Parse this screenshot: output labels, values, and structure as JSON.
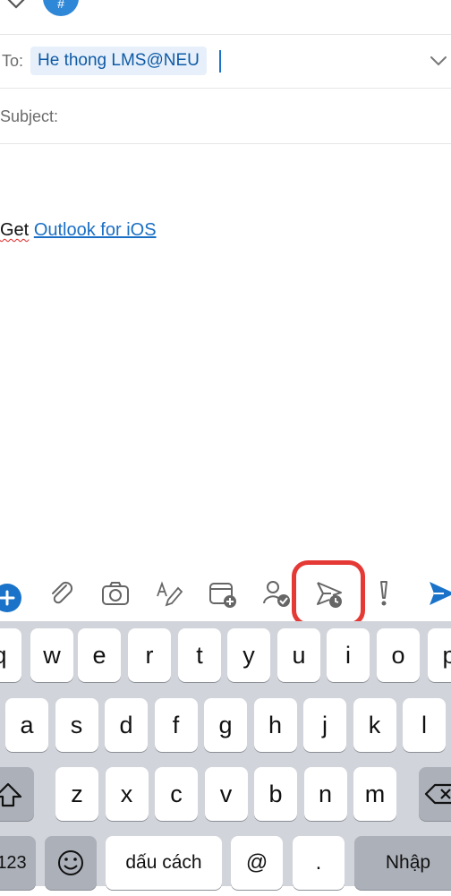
{
  "header": {
    "avatar_letter": "#"
  },
  "compose": {
    "to_label": "To:",
    "to_recipient": "He thong LMS@NEU",
    "subject_label": "Subject:",
    "signature_prefix": "Get",
    "signature_link": "Outlook for iOS"
  },
  "colors": {
    "accent": "#1a73c9",
    "highlight": "#e53935",
    "keyboard_bg": "#d1d4da"
  },
  "toolbar": {
    "icons": [
      "plus-icon",
      "attach-icon",
      "camera-icon",
      "format-text-icon",
      "calendar-add-icon",
      "contact-check-icon",
      "schedule-send-icon",
      "importance-icon",
      "send-icon"
    ]
  },
  "keyboard": {
    "row1": [
      "q",
      "w",
      "e",
      "r",
      "t",
      "y",
      "u",
      "i",
      "o",
      "p"
    ],
    "row2": [
      "a",
      "s",
      "d",
      "f",
      "g",
      "h",
      "j",
      "k",
      "l"
    ],
    "row3": [
      "z",
      "x",
      "c",
      "v",
      "b",
      "n",
      "m"
    ],
    "numbers_label": "123",
    "space_label": "dấu cách",
    "at_label": "@",
    "dot_label": ".",
    "return_label": "Nhập"
  }
}
